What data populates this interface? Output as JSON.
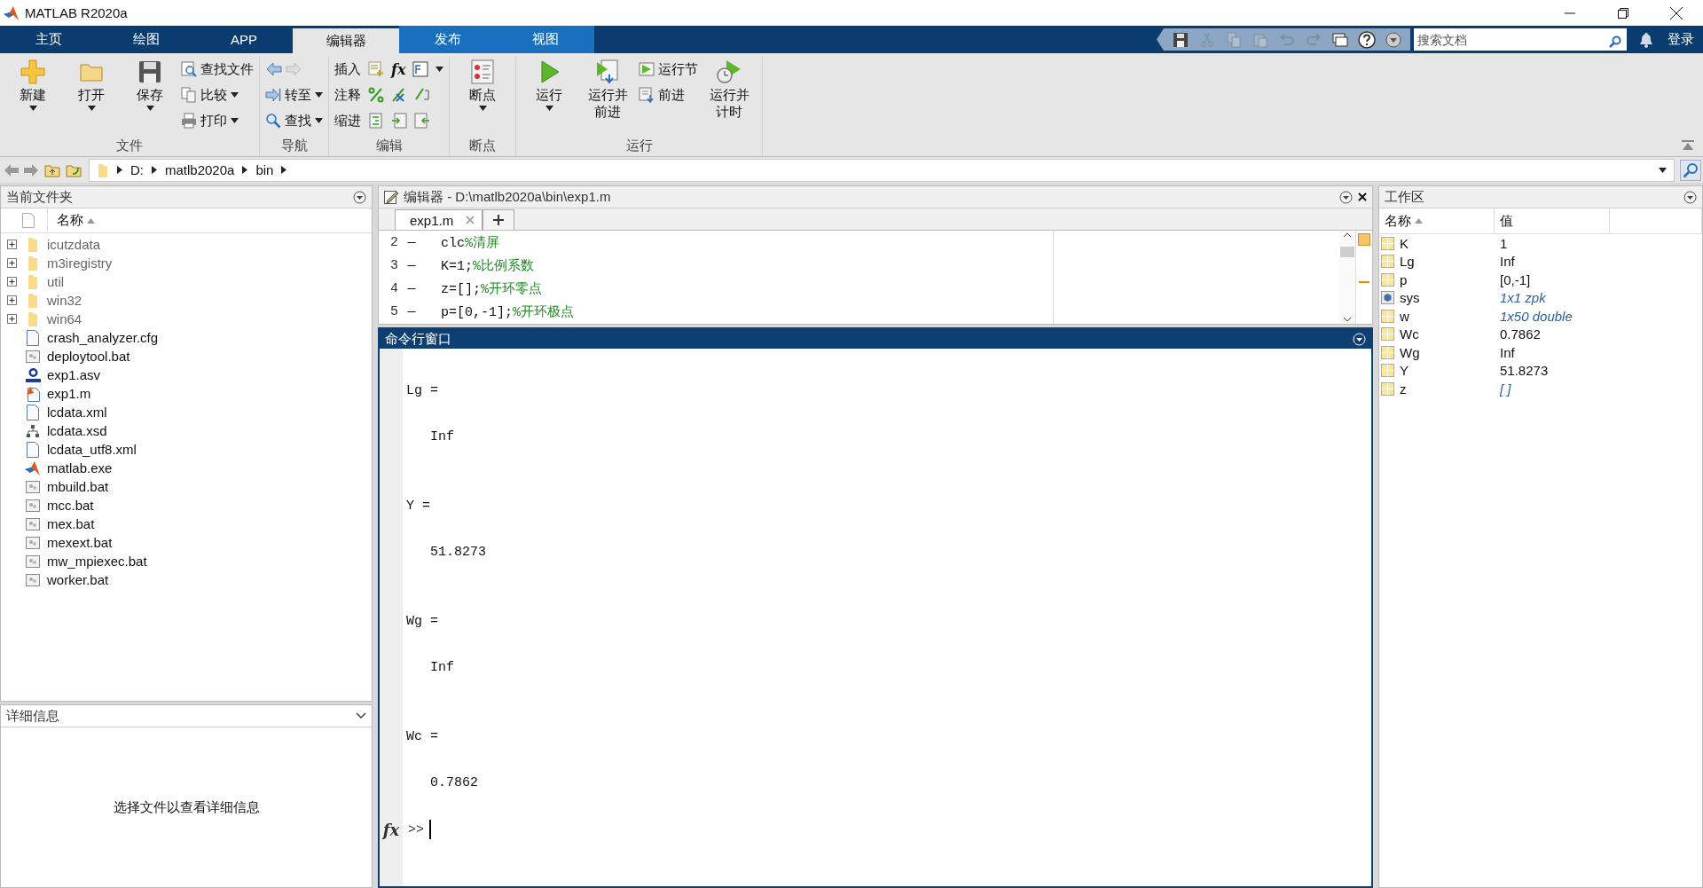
{
  "window": {
    "title": "MATLAB R2020a",
    "sign_in": "登录"
  },
  "tabs": [
    {
      "label": "主页",
      "selected": false,
      "contextual": false
    },
    {
      "label": "绘图",
      "selected": false,
      "contextual": false
    },
    {
      "label": "APP",
      "selected": false,
      "contextual": false
    },
    {
      "label": "编辑器",
      "selected": true,
      "contextual": true
    },
    {
      "label": "发布",
      "selected": false,
      "contextual": true
    },
    {
      "label": "视图",
      "selected": false,
      "contextual": true
    }
  ],
  "quick_access": [
    {
      "disabled": false
    },
    {
      "disabled": true
    },
    {
      "disabled": true
    },
    {
      "disabled": true
    },
    {
      "disabled": true
    },
    {
      "disabled": true
    },
    {
      "disabled": false
    },
    {
      "disabled": false
    },
    {
      "disabled": false
    }
  ],
  "search": {
    "placeholder": "搜索文档"
  },
  "ribbon": [
    {
      "label": "文件",
      "groups": [
        {
          "kind": "large",
          "label": "新建",
          "dropdown": true
        },
        {
          "kind": "large",
          "label": "打开",
          "dropdown": true
        },
        {
          "kind": "large",
          "label": "保存",
          "dropdown": true
        },
        {
          "kind": "stack",
          "items": [
            {
              "label": "查找文件",
              "dropdown": false
            },
            {
              "label": "比较",
              "dropdown": true
            },
            {
              "label": "打印",
              "dropdown": true
            }
          ]
        }
      ]
    },
    {
      "label": "导航",
      "groups": [
        {
          "kind": "stack",
          "items": [
            {
              "dropdown": false
            },
            {
              "label": "转至",
              "dropdown": true
            },
            {
              "label": "查找",
              "dropdown": true
            }
          ]
        }
      ]
    },
    {
      "label": "编辑",
      "groups": [
        {
          "kind": "tools",
          "items": [
            {
              "label": "插入",
              "symbol": "fx",
              "dropdown": true
            },
            {
              "label": "注释",
              "dropdown": false
            },
            {
              "label": "缩进",
              "dropdown": false
            }
          ]
        }
      ]
    },
    {
      "label": "断点",
      "groups": [
        {
          "kind": "large",
          "label": "断点",
          "dropdown": true
        }
      ]
    },
    {
      "label": "运行",
      "groups": [
        {
          "kind": "large",
          "label": "运行",
          "dropdown": true
        },
        {
          "kind": "large",
          "label": "运行并前进",
          "dropdown": false
        },
        {
          "kind": "stack",
          "items": [
            {
              "label": "运行节",
              "dropdown": false
            },
            {
              "label": "前进",
              "dropdown": false
            }
          ]
        },
        {
          "kind": "large",
          "label": "运行并计时",
          "dropdown": false
        }
      ]
    }
  ],
  "address_bar": {
    "path": [
      "D:",
      "matlb2020a",
      "bin"
    ]
  },
  "current_folder": {
    "title": "当前文件夹",
    "column": "名称",
    "items": [
      {
        "name": "icutzdata",
        "kind": "folder",
        "expanded": false
      },
      {
        "name": "m3iregistry",
        "kind": "folder",
        "expanded": false
      },
      {
        "name": "util",
        "kind": "folder",
        "expanded": false
      },
      {
        "name": "win32",
        "kind": "folder",
        "expanded": false
      },
      {
        "name": "win64",
        "kind": "folder",
        "expanded": false
      },
      {
        "name": "crash_analyzer.cfg",
        "kind": "text"
      },
      {
        "name": "deploytool.bat",
        "kind": "bat"
      },
      {
        "name": "exp1.asv",
        "kind": "asv"
      },
      {
        "name": "exp1.m",
        "kind": "m"
      },
      {
        "name": "lcdata.xml",
        "kind": "text"
      },
      {
        "name": "lcdata.xsd",
        "kind": "xsd"
      },
      {
        "name": "lcdata_utf8.xml",
        "kind": "text"
      },
      {
        "name": "matlab.exe",
        "kind": "exe"
      },
      {
        "name": "mbuild.bat",
        "kind": "bat"
      },
      {
        "name": "mcc.bat",
        "kind": "bat"
      },
      {
        "name": "mex.bat",
        "kind": "bat"
      },
      {
        "name": "mexext.bat",
        "kind": "bat"
      },
      {
        "name": "mw_mpiexec.bat",
        "kind": "bat"
      },
      {
        "name": "worker.bat",
        "kind": "bat"
      }
    ]
  },
  "details": {
    "title": "详细信息",
    "message": "选择文件以查看详细信息"
  },
  "editor": {
    "title": "编辑器 - D:\\matlb2020a\\bin\\exp1.m",
    "tabs": [
      {
        "label": "exp1.m",
        "selected": true
      }
    ],
    "lines": [
      {
        "number": "2",
        "marker": "—",
        "code": "clc",
        "comment": "%清屏"
      },
      {
        "number": "3",
        "marker": "—",
        "code": "K=1;",
        "comment": "%比例系数"
      },
      {
        "number": "4",
        "marker": "—",
        "code": "z=[];",
        "comment": "%开环零点"
      },
      {
        "number": "5",
        "marker": "—",
        "code": "p=[0,-1];",
        "comment": "%开环极点"
      }
    ]
  },
  "command_window": {
    "title": "命令行窗口",
    "prompt_icon": "fx",
    "prompt": ">>",
    "output": [
      {
        "kind": "name",
        "text": "Lg ="
      },
      {
        "kind": "value",
        "text": "Inf"
      },
      {
        "kind": "name",
        "text": "Y ="
      },
      {
        "kind": "value",
        "text": "51.8273"
      },
      {
        "kind": "name",
        "text": "Wg ="
      },
      {
        "kind": "value",
        "text": "Inf"
      },
      {
        "kind": "name",
        "text": "Wc ="
      },
      {
        "kind": "value",
        "text": "0.7862"
      }
    ]
  },
  "workspace": {
    "title": "工作区",
    "columns": [
      "名称",
      "值"
    ],
    "rows": [
      {
        "name": "K",
        "value": "1",
        "kind": "matrix",
        "summary": false
      },
      {
        "name": "Lg",
        "value": "Inf",
        "kind": "matrix",
        "summary": false
      },
      {
        "name": "p",
        "value": "[0,-1]",
        "kind": "matrix",
        "summary": false
      },
      {
        "name": "sys",
        "value": "1x1 zpk",
        "kind": "object",
        "summary": true
      },
      {
        "name": "w",
        "value": "1x50 double",
        "kind": "matrix",
        "summary": true
      },
      {
        "name": "Wc",
        "value": "0.7862",
        "kind": "matrix",
        "summary": false
      },
      {
        "name": "Wg",
        "value": "Inf",
        "kind": "matrix",
        "summary": false
      },
      {
        "name": "Y",
        "value": "51.8273",
        "kind": "matrix",
        "summary": false
      },
      {
        "name": "z",
        "value": "[ ]",
        "kind": "matrix",
        "summary": true
      }
    ]
  }
}
